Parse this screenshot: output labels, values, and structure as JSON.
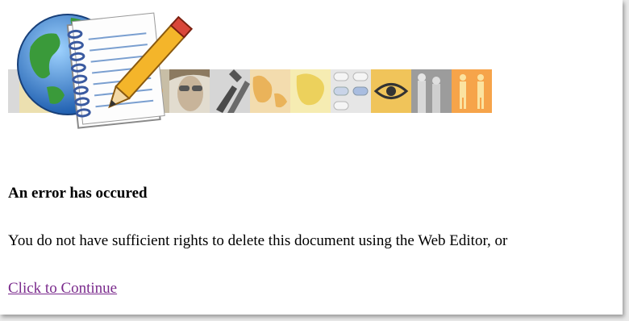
{
  "error": {
    "heading": "An error has occured",
    "message": "You do not have sufficient rights to delete this document using the Web Editor, or",
    "continue_link": "Click to Continue"
  },
  "banner": {
    "icon": "globe-notebook-pencil-icon",
    "tiles": [
      {
        "icon": "yellow-block",
        "color": "#e9d08a"
      },
      {
        "icon": "flower-icon",
        "color": "#c9c0a8"
      },
      {
        "icon": "face-photo",
        "color": "#d8d0c0"
      },
      {
        "icon": "hands-photo",
        "color": "#cfcfcf"
      },
      {
        "icon": "map-icon",
        "color": "#f2d49a"
      },
      {
        "icon": "map-yellow-icon",
        "color": "#f2e28e"
      },
      {
        "icon": "keypad-icon",
        "color": "#dcdcdc"
      },
      {
        "icon": "eye-icon",
        "color": "#f0c050"
      },
      {
        "icon": "people-photo",
        "color": "#9a9a9a"
      },
      {
        "icon": "restroom-figures-icon",
        "color": "#f5a346"
      }
    ]
  }
}
